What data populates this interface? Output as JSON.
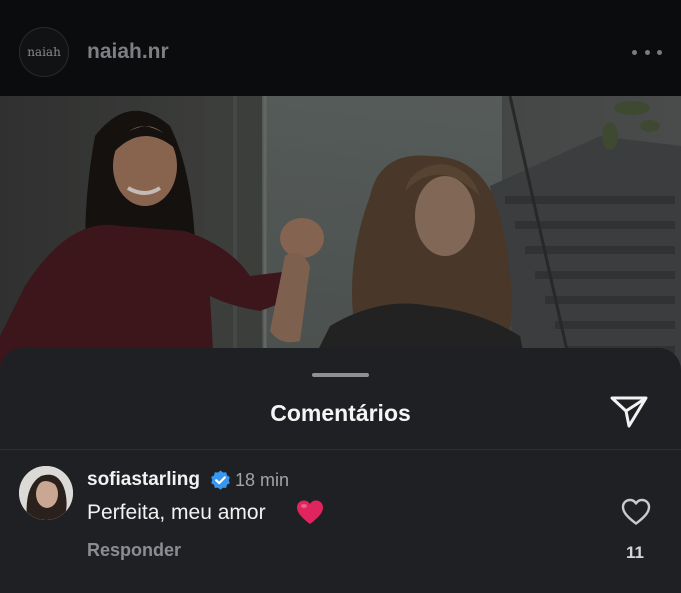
{
  "header": {
    "logo_text": "naiah",
    "username": "naiah.nr",
    "more_icon": "more-horizontal-icon"
  },
  "photo": {
    "description_icon": "post-photo"
  },
  "comments_sheet": {
    "title": "Comentários",
    "share_icon": "send-icon"
  },
  "comment": {
    "username": "sofiastarling",
    "verified_icon": "verified-badge-icon",
    "time": "18 min",
    "text": "Perfeita, meu amor",
    "emoji": "red-heart",
    "reply_label": "Responder",
    "like_icon": "heart-outline-icon",
    "like_count": "11"
  },
  "colors": {
    "background": "#0c0d0f",
    "sheet": "#1f2023",
    "verified": "#3897f0",
    "heart": "#e0245e"
  }
}
